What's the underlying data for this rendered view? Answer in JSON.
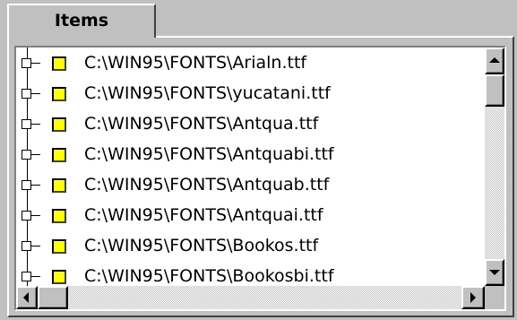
{
  "tab": {
    "label": "Items"
  },
  "tree": {
    "items": [
      {
        "label": "C:\\WIN95\\FONTS\\Arialn.ttf"
      },
      {
        "label": "C:\\WIN95\\FONTS\\yucatani.ttf"
      },
      {
        "label": "C:\\WIN95\\FONTS\\Antqua.ttf"
      },
      {
        "label": "C:\\WIN95\\FONTS\\Antquabi.ttf"
      },
      {
        "label": "C:\\WIN95\\FONTS\\Antquab.ttf"
      },
      {
        "label": "C:\\WIN95\\FONTS\\Antquai.ttf"
      },
      {
        "label": "C:\\WIN95\\FONTS\\Bookos.ttf"
      },
      {
        "label": "C:\\WIN95\\FONTS\\Bookosbi.ttf"
      }
    ]
  },
  "colors": {
    "face": "#c0c0c0",
    "list_bg": "#ffffff",
    "icon_fill": "#ffff00"
  },
  "icons": {
    "expander": "plus-box-icon",
    "item": "yellow-square-icon",
    "scroll_up": "arrow-up-icon",
    "scroll_down": "arrow-down-icon",
    "scroll_left": "arrow-left-icon",
    "scroll_right": "arrow-right-icon"
  }
}
